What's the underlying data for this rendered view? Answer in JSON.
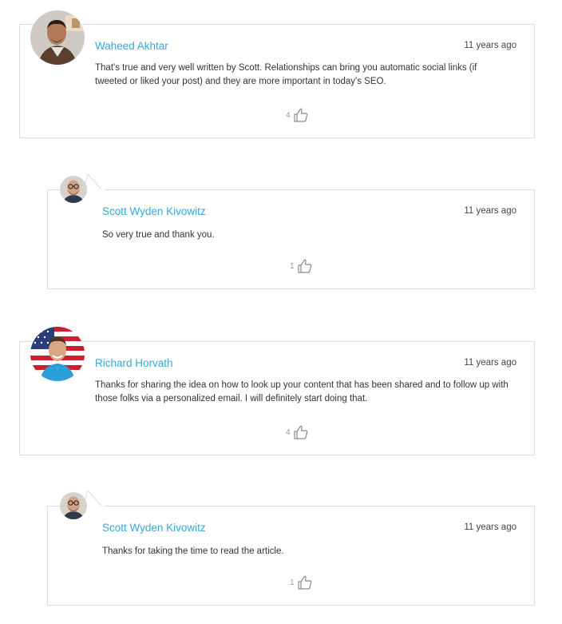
{
  "comments": [
    {
      "author": "Waheed Akhtar",
      "time": "11 years ago",
      "text": "That's true and very well written by Scott. Relationships can bring you automatic social links (if tweeted or liked your post) and they are more important in today's SEO.",
      "likes": "4"
    },
    {
      "author": "Scott Wyden Kivowitz",
      "time": "11 years ago",
      "text": "So very true and thank you.",
      "likes": "1"
    },
    {
      "author": "Richard Horvath",
      "time": "11 years ago",
      "text": "Thanks for sharing the idea on how to look up your content that has been shared and to follow up with those folks via a personalized email. I will definitely start doing that.",
      "likes": "4"
    },
    {
      "author": "Scott Wyden Kivowitz",
      "time": "11 years ago",
      "text": "Thanks for taking the time to read the article.",
      "likes": "1"
    }
  ],
  "colors": {
    "author": "#3aa6d6",
    "border": "#dcdcdc",
    "like_icon": "#8a8a8a"
  },
  "icons": {
    "like": "thumbs-up-icon"
  }
}
